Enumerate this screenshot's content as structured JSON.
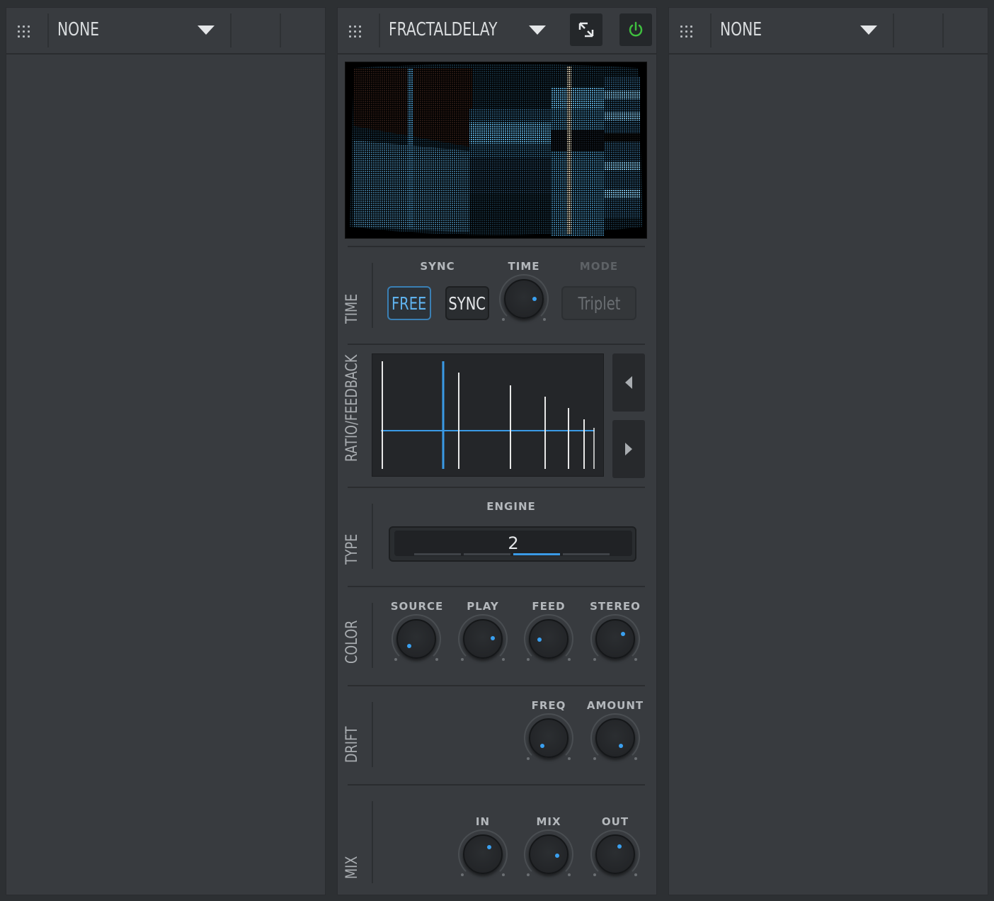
{
  "slots": {
    "left": {
      "name": "NONE"
    },
    "center": {
      "name": "FRACTALDELAY"
    },
    "right": {
      "name": "NONE"
    }
  },
  "time_section": {
    "label": "TIME",
    "sync_caption": "SYNC",
    "time_caption": "TIME",
    "mode_caption": "MODE",
    "free_label": "FREE",
    "sync_label": "SYNC",
    "mode_value": "Triplet",
    "time_knob": 0.75
  },
  "ratio_section": {
    "label": "RATIO/FEEDBACK"
  },
  "type_section": {
    "label": "TYPE",
    "engine_caption": "ENGINE",
    "engine_value": "2"
  },
  "color_section": {
    "label": "COLOR",
    "knobs": [
      {
        "caption": "SOURCE",
        "value": 0.2
      },
      {
        "caption": "PLAY",
        "value": 0.7
      },
      {
        "caption": "FEED",
        "value": 0.3
      },
      {
        "caption": "STEREO",
        "value": 0.65
      }
    ]
  },
  "drift_section": {
    "label": "DRIFT",
    "knobs": [
      {
        "caption": "FREQ",
        "value": 0.25
      },
      {
        "caption": "AMOUNT",
        "value": 0.8
      }
    ]
  },
  "mix_section": {
    "label": "MIX",
    "knobs": [
      {
        "caption": "IN",
        "value": 0.62
      },
      {
        "caption": "MIX",
        "value": 0.7
      },
      {
        "caption": "OUT",
        "value": 0.6
      }
    ]
  },
  "colors": {
    "accent": "#3aa0f0",
    "power": "#3fbf3f"
  }
}
